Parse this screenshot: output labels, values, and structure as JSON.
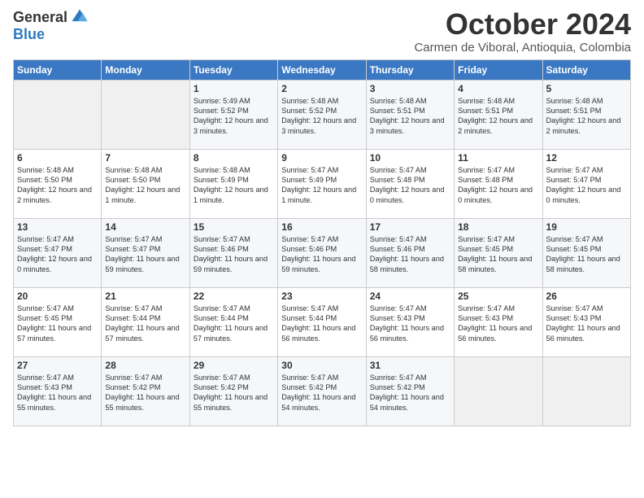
{
  "logo": {
    "general": "General",
    "blue": "Blue"
  },
  "title": "October 2024",
  "location": "Carmen de Viboral, Antioquia, Colombia",
  "days_of_week": [
    "Sunday",
    "Monday",
    "Tuesday",
    "Wednesday",
    "Thursday",
    "Friday",
    "Saturday"
  ],
  "weeks": [
    [
      {
        "day": "",
        "info": ""
      },
      {
        "day": "",
        "info": ""
      },
      {
        "day": "1",
        "info": "Sunrise: 5:49 AM\nSunset: 5:52 PM\nDaylight: 12 hours and 3 minutes."
      },
      {
        "day": "2",
        "info": "Sunrise: 5:48 AM\nSunset: 5:52 PM\nDaylight: 12 hours and 3 minutes."
      },
      {
        "day": "3",
        "info": "Sunrise: 5:48 AM\nSunset: 5:51 PM\nDaylight: 12 hours and 3 minutes."
      },
      {
        "day": "4",
        "info": "Sunrise: 5:48 AM\nSunset: 5:51 PM\nDaylight: 12 hours and 2 minutes."
      },
      {
        "day": "5",
        "info": "Sunrise: 5:48 AM\nSunset: 5:51 PM\nDaylight: 12 hours and 2 minutes."
      }
    ],
    [
      {
        "day": "6",
        "info": "Sunrise: 5:48 AM\nSunset: 5:50 PM\nDaylight: 12 hours and 2 minutes."
      },
      {
        "day": "7",
        "info": "Sunrise: 5:48 AM\nSunset: 5:50 PM\nDaylight: 12 hours and 1 minute."
      },
      {
        "day": "8",
        "info": "Sunrise: 5:48 AM\nSunset: 5:49 PM\nDaylight: 12 hours and 1 minute."
      },
      {
        "day": "9",
        "info": "Sunrise: 5:47 AM\nSunset: 5:49 PM\nDaylight: 12 hours and 1 minute."
      },
      {
        "day": "10",
        "info": "Sunrise: 5:47 AM\nSunset: 5:48 PM\nDaylight: 12 hours and 0 minutes."
      },
      {
        "day": "11",
        "info": "Sunrise: 5:47 AM\nSunset: 5:48 PM\nDaylight: 12 hours and 0 minutes."
      },
      {
        "day": "12",
        "info": "Sunrise: 5:47 AM\nSunset: 5:47 PM\nDaylight: 12 hours and 0 minutes."
      }
    ],
    [
      {
        "day": "13",
        "info": "Sunrise: 5:47 AM\nSunset: 5:47 PM\nDaylight: 12 hours and 0 minutes."
      },
      {
        "day": "14",
        "info": "Sunrise: 5:47 AM\nSunset: 5:47 PM\nDaylight: 11 hours and 59 minutes."
      },
      {
        "day": "15",
        "info": "Sunrise: 5:47 AM\nSunset: 5:46 PM\nDaylight: 11 hours and 59 minutes."
      },
      {
        "day": "16",
        "info": "Sunrise: 5:47 AM\nSunset: 5:46 PM\nDaylight: 11 hours and 59 minutes."
      },
      {
        "day": "17",
        "info": "Sunrise: 5:47 AM\nSunset: 5:46 PM\nDaylight: 11 hours and 58 minutes."
      },
      {
        "day": "18",
        "info": "Sunrise: 5:47 AM\nSunset: 5:45 PM\nDaylight: 11 hours and 58 minutes."
      },
      {
        "day": "19",
        "info": "Sunrise: 5:47 AM\nSunset: 5:45 PM\nDaylight: 11 hours and 58 minutes."
      }
    ],
    [
      {
        "day": "20",
        "info": "Sunrise: 5:47 AM\nSunset: 5:45 PM\nDaylight: 11 hours and 57 minutes."
      },
      {
        "day": "21",
        "info": "Sunrise: 5:47 AM\nSunset: 5:44 PM\nDaylight: 11 hours and 57 minutes."
      },
      {
        "day": "22",
        "info": "Sunrise: 5:47 AM\nSunset: 5:44 PM\nDaylight: 11 hours and 57 minutes."
      },
      {
        "day": "23",
        "info": "Sunrise: 5:47 AM\nSunset: 5:44 PM\nDaylight: 11 hours and 56 minutes."
      },
      {
        "day": "24",
        "info": "Sunrise: 5:47 AM\nSunset: 5:43 PM\nDaylight: 11 hours and 56 minutes."
      },
      {
        "day": "25",
        "info": "Sunrise: 5:47 AM\nSunset: 5:43 PM\nDaylight: 11 hours and 56 minutes."
      },
      {
        "day": "26",
        "info": "Sunrise: 5:47 AM\nSunset: 5:43 PM\nDaylight: 11 hours and 56 minutes."
      }
    ],
    [
      {
        "day": "27",
        "info": "Sunrise: 5:47 AM\nSunset: 5:43 PM\nDaylight: 11 hours and 55 minutes."
      },
      {
        "day": "28",
        "info": "Sunrise: 5:47 AM\nSunset: 5:42 PM\nDaylight: 11 hours and 55 minutes."
      },
      {
        "day": "29",
        "info": "Sunrise: 5:47 AM\nSunset: 5:42 PM\nDaylight: 11 hours and 55 minutes."
      },
      {
        "day": "30",
        "info": "Sunrise: 5:47 AM\nSunset: 5:42 PM\nDaylight: 11 hours and 54 minutes."
      },
      {
        "day": "31",
        "info": "Sunrise: 5:47 AM\nSunset: 5:42 PM\nDaylight: 11 hours and 54 minutes."
      },
      {
        "day": "",
        "info": ""
      },
      {
        "day": "",
        "info": ""
      }
    ]
  ]
}
